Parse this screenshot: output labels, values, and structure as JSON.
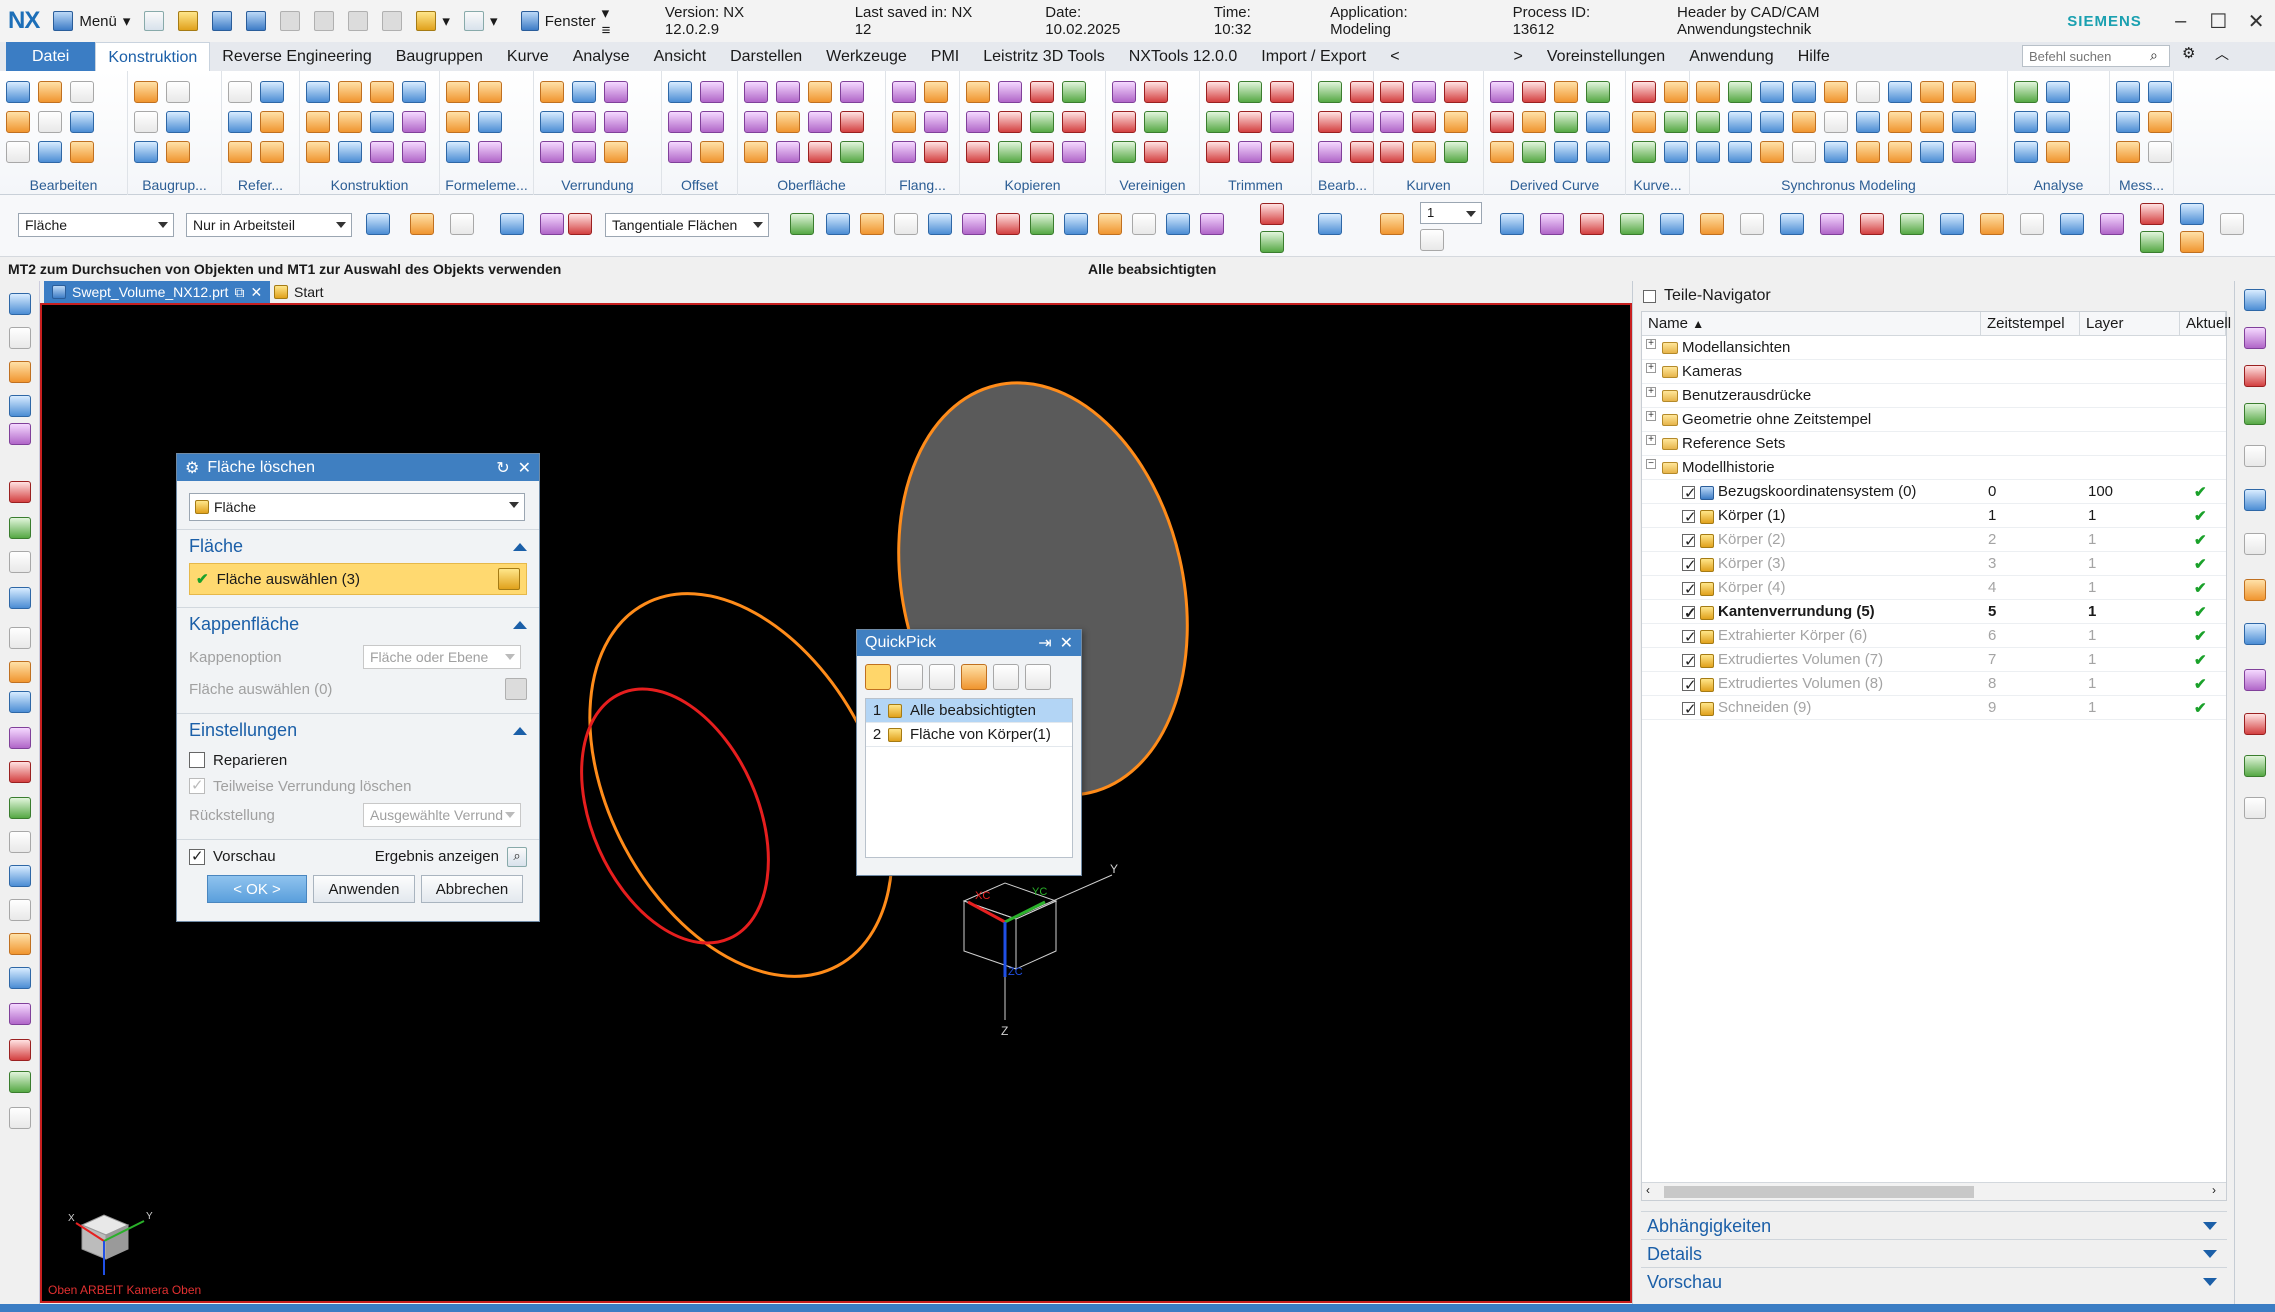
{
  "titlebar": {
    "logo": "NX",
    "menu_label": "Menü",
    "window_label": "Fenster",
    "version": "Version: NX 12.0.2.9",
    "saved": "Last saved in: NX 12",
    "date": "Date: 10.02.2025",
    "time": "Time: 10:32",
    "application": "Application: Modeling",
    "process": "Process ID: 13612",
    "header": "Header by CAD/CAM Anwendungstechnik",
    "brand": "SIEMENS"
  },
  "menubar": {
    "tabs": [
      "Datei",
      "Konstruktion",
      "Reverse Engineering",
      "Baugruppen",
      "Kurve",
      "Analyse",
      "Ansicht",
      "Darstellen",
      "Werkzeuge",
      "PMI",
      "Leistritz 3D Tools",
      "NXTools 12.0.0",
      "Import / Export",
      "<",
      ">",
      "Voreinstellungen",
      "Anwendung",
      "Hilfe"
    ],
    "search_placeholder": "Befehl suchen"
  },
  "ribbon": {
    "groups": [
      "Bearbeiten",
      "Baugrup...",
      "Refer...",
      "Konstruktion",
      "Formeleme...",
      "Verrundung",
      "Offset",
      "Oberfläche",
      "Flang...",
      "Kopieren",
      "Vereinigen",
      "Trimmen",
      "Bearb...",
      "Kurven",
      "Derived Curve",
      "Kurve...",
      "Synchronus Modeling",
      "Analyse",
      "Mess..."
    ]
  },
  "selbar": {
    "filter": "Fläche",
    "scope": "Nur in Arbeitsteil",
    "rule": "Tangentiale Flächen",
    "count": "1"
  },
  "status": {
    "prompt": "MT2 zum Durchsuchen von Objekten und MT1 zur Auswahl des Objekts verwenden",
    "center": "Alle beabsichtigten"
  },
  "doctabs": {
    "file": "Swept_Volume_NX12.prt",
    "start": "Start"
  },
  "viewport": {
    "label": "Oben ARBEIT Kamera Oben",
    "axis_x": "X",
    "axis_y": "Y",
    "axis_z": "Z",
    "triad_xc": "XC",
    "triad_yc": "YC",
    "triad_zc": "ZC",
    "colors": {
      "background": "#000000",
      "orange": "#ff8c1a",
      "red": "#e61e1e",
      "face": "#5a5a5a"
    }
  },
  "dialog": {
    "title": "Fläche löschen",
    "type": "Fläche",
    "sec1": "Fläche",
    "select_face": "Fläche auswählen (3)",
    "sec2": "Kappenfläche",
    "cap_option_label": "Kappenoption",
    "cap_option_value": "Fläche oder Ebene",
    "cap_select": "Fläche auswählen (0)",
    "sec3": "Einstellungen",
    "repair": "Reparieren",
    "partial": "Teilweise Verrundung löschen",
    "reset_label": "Rückstellung",
    "reset_value": "Ausgewählte Verrund",
    "preview": "Vorschau",
    "show_result": "Ergebnis anzeigen",
    "ok": "< OK >",
    "apply": "Anwenden",
    "cancel": "Abbrechen"
  },
  "quickpick": {
    "title": "QuickPick",
    "items": [
      {
        "num": "1",
        "label": "Alle beabsichtigten"
      },
      {
        "num": "2",
        "label": "Fläche von Körper(1)"
      }
    ]
  },
  "navigator": {
    "title": "Teile-Navigator",
    "columns": [
      "Name",
      "Zeitstempel",
      "Layer",
      "Aktuell"
    ],
    "folders": [
      "Modellansichten",
      "Kameras",
      "Benutzerausdrücke",
      "Geometrie ohne Zeitstempel",
      "Reference Sets",
      "Modellhistorie"
    ],
    "history": [
      {
        "name": "Bezugskoordinatensystem (0)",
        "ts": "0",
        "layer": "100",
        "dim": false,
        "bold": false
      },
      {
        "name": "Körper (1)",
        "ts": "1",
        "layer": "1",
        "dim": false,
        "bold": false
      },
      {
        "name": "Körper (2)",
        "ts": "2",
        "layer": "1",
        "dim": true,
        "bold": false
      },
      {
        "name": "Körper (3)",
        "ts": "3",
        "layer": "1",
        "dim": true,
        "bold": false
      },
      {
        "name": "Körper (4)",
        "ts": "4",
        "layer": "1",
        "dim": true,
        "bold": false
      },
      {
        "name": "Kantenverrundung (5)",
        "ts": "5",
        "layer": "1",
        "dim": false,
        "bold": true
      },
      {
        "name": "Extrahierter Körper (6)",
        "ts": "6",
        "layer": "1",
        "dim": true,
        "bold": false
      },
      {
        "name": "Extrudiertes Volumen (7)",
        "ts": "7",
        "layer": "1",
        "dim": true,
        "bold": false
      },
      {
        "name": "Extrudiertes Volumen (8)",
        "ts": "8",
        "layer": "1",
        "dim": true,
        "bold": false
      },
      {
        "name": "Schneiden (9)",
        "ts": "9",
        "layer": "1",
        "dim": true,
        "bold": false
      }
    ],
    "sections": [
      "Abhängigkeiten",
      "Details",
      "Vorschau"
    ]
  }
}
